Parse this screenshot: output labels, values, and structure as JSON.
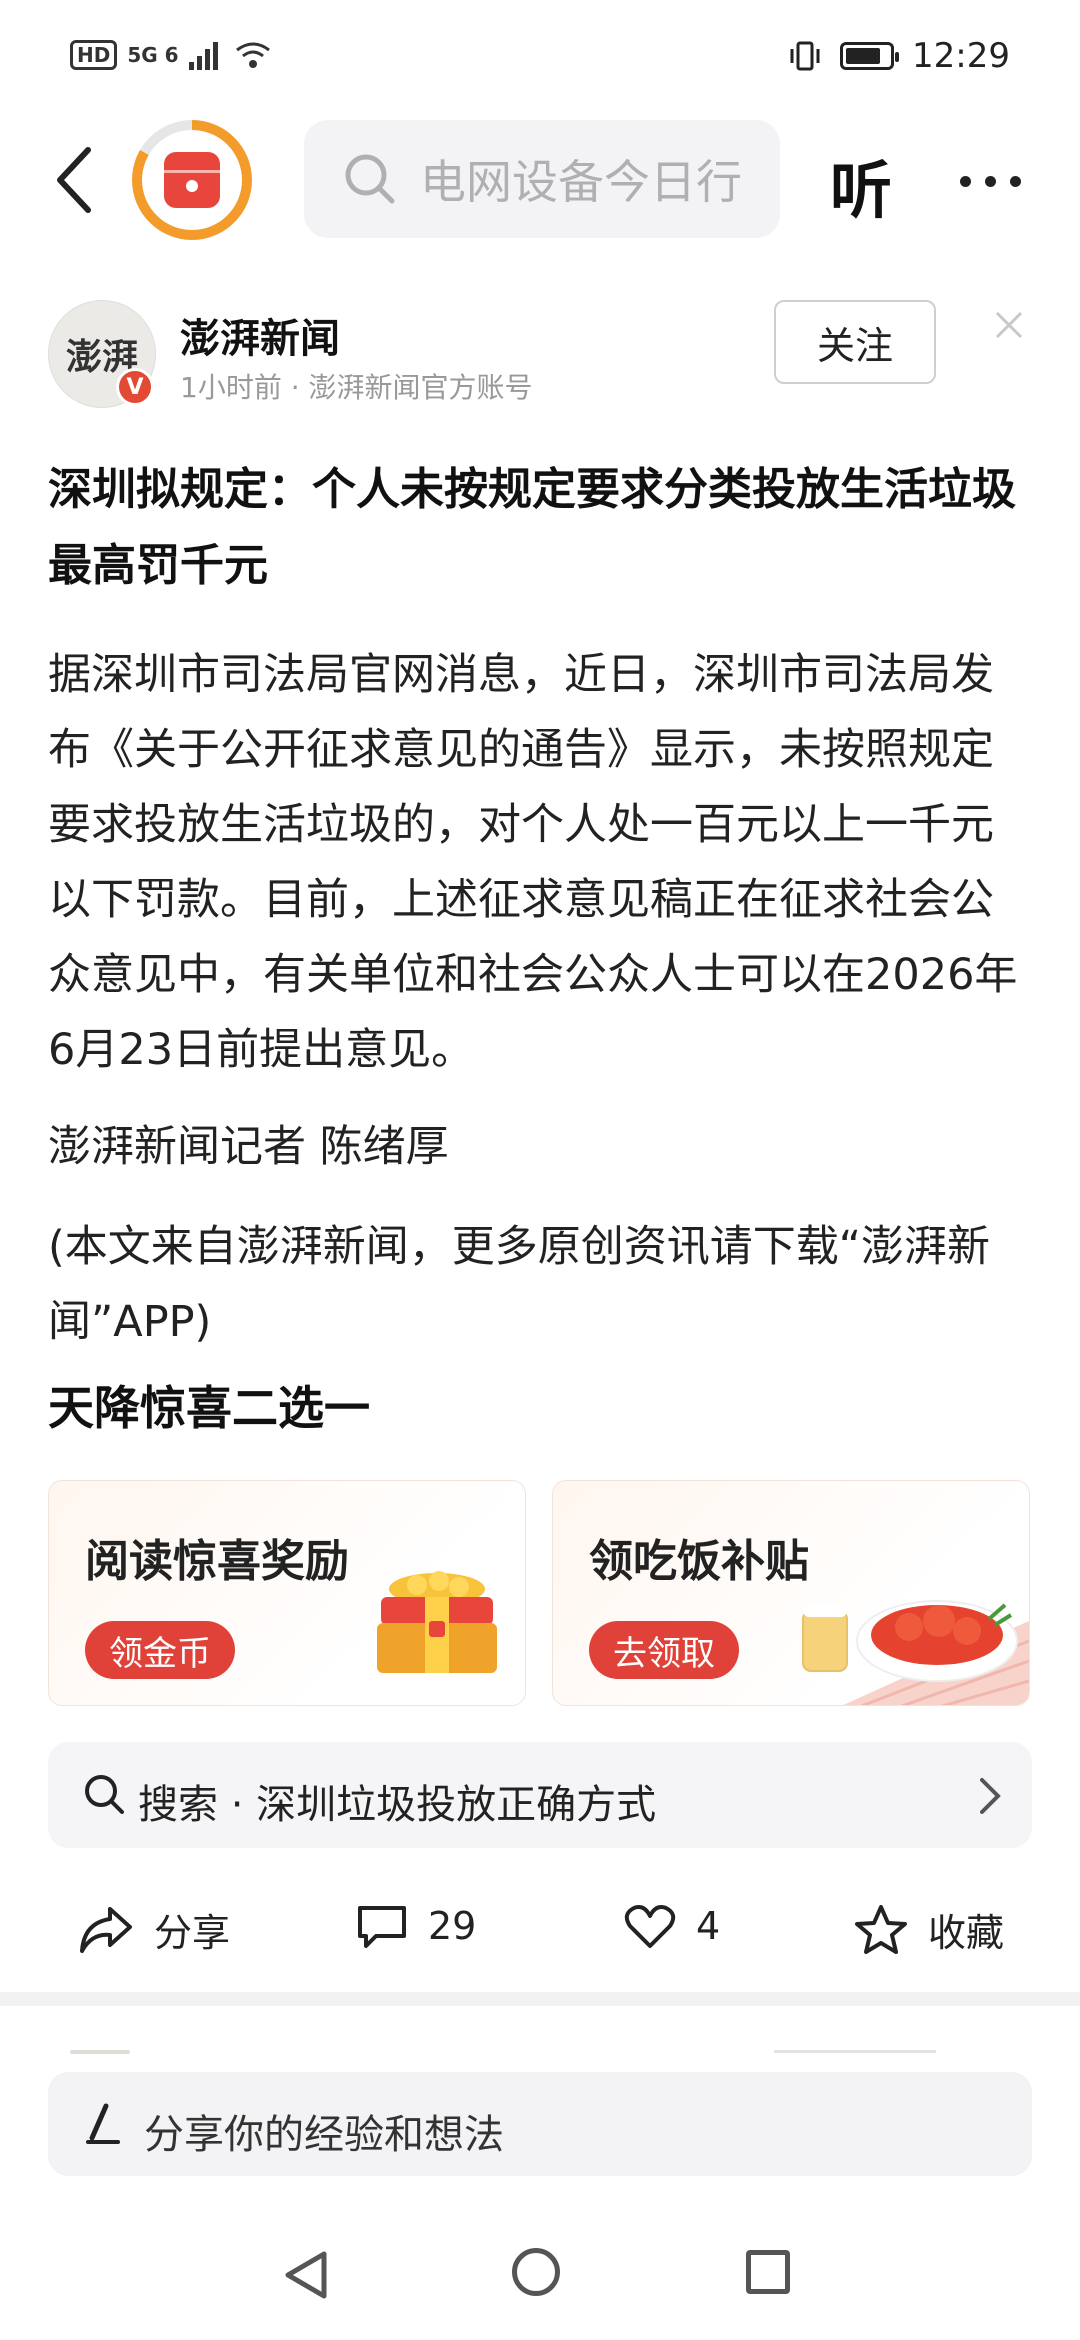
{
  "status_bar": {
    "left_indicators": "5G 6",
    "hd_label": "HD",
    "time": "12:29",
    "battery_level": 0.8
  },
  "nav": {
    "search_placeholder": "电网设备今日行",
    "listen_label": "听"
  },
  "author": {
    "name": "澎湃新闻",
    "avatar_text": "澎湃",
    "meta": "1小时前 · 澎湃新闻官方账号",
    "follow_label": "关注",
    "verified_label": "V"
  },
  "article": {
    "title": "深圳拟规定：个人未按规定要求分类投放生活垃圾最高罚千元",
    "body": "据深圳市司法局官网消息，近日，深圳市司法局发布《关于公开征求意见的通告》显示，未按照规定要求投放生活垃圾的，对个人处一百元以上一千元以下罚款。目前，上述征求意见稿正在征求社会公众意见中，有关单位和社会公众人士可以在2026年6月23日前提出意见。",
    "reporter": "澎湃新闻记者 陈绪厚",
    "source_note": "(本文来自澎湃新闻，更多原创资讯请下载“澎湃新闻”APP)"
  },
  "promo": {
    "heading": "天降惊喜二选一",
    "cards": [
      {
        "title": "阅读惊喜奖励",
        "button": "领金币"
      },
      {
        "title": "领吃饭补贴",
        "button": "去领取"
      }
    ]
  },
  "search_suggestion": {
    "text": "搜索 · 深圳垃圾投放正确方式"
  },
  "actions": {
    "share_label": "分享",
    "comment_count": "29",
    "like_count": "4",
    "favorite_label": "收藏"
  },
  "comment_input": {
    "placeholder": "分享你的经验和想法"
  },
  "colors": {
    "accent_red": "#e0423a",
    "ring_orange": "#f39c2c"
  }
}
